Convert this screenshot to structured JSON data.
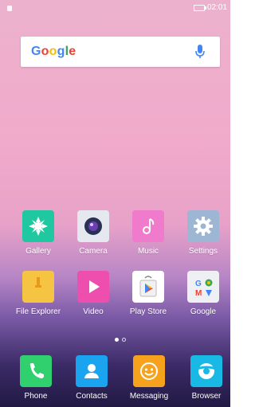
{
  "status": {
    "time": "02:01"
  },
  "search": {
    "brand": [
      "G",
      "o",
      "o",
      "g",
      "l",
      "e"
    ]
  },
  "apps_row1": [
    {
      "label": "Gallery"
    },
    {
      "label": "Camera"
    },
    {
      "label": "Music"
    },
    {
      "label": "Settings"
    }
  ],
  "apps_row2": [
    {
      "label": "File Explorer"
    },
    {
      "label": "Video"
    },
    {
      "label": "Play Store"
    },
    {
      "label": "Google"
    }
  ],
  "dock": [
    {
      "label": "Phone"
    },
    {
      "label": "Contacts"
    },
    {
      "label": "Messaging"
    },
    {
      "label": "Browser"
    }
  ]
}
